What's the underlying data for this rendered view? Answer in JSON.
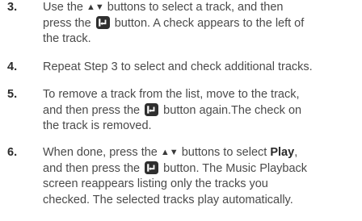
{
  "steps": [
    {
      "number": "3.",
      "lines": [
        [
          "Use the ",
          "▲▼",
          " buttons to select a track, and then"
        ],
        [
          "press the ",
          "[enter]",
          " button. A check appears to the left of"
        ],
        [
          "the track."
        ]
      ]
    },
    {
      "number": "4.",
      "lines": [
        [
          "Repeat Step 3 to select and check additional tracks."
        ]
      ]
    },
    {
      "number": "5.",
      "lines": [
        [
          "To remove a track from the list, move to the track,"
        ],
        [
          "and then press the ",
          "[enter]",
          " button again.The check on"
        ],
        [
          "the track is removed."
        ]
      ]
    },
    {
      "number": "6.",
      "lines": [
        [
          "When done, press the ",
          "▲▼",
          " buttons to select ",
          "Play",
          ","
        ],
        [
          "and then press the ",
          "[enter]",
          " button. The Music Playback"
        ],
        [
          "screen reappears listing only the tracks you"
        ],
        [
          "checked. The selected tracks play automatically."
        ]
      ]
    }
  ],
  "text": {
    "s3_l1_a": "Use the ",
    "s3_l1_arrows": "▲▼",
    "s3_l1_b": " buttons to select a track, and then",
    "s3_l2_a": "press the ",
    "s3_l2_b": " button. A check appears to the left of",
    "s3_l3": "the track.",
    "s4_l1": "Repeat Step 3 to select and check additional tracks.",
    "s5_l1": "To remove a track from the list, move to the track,",
    "s5_l2_a": "and then press the ",
    "s5_l2_b": " button again.The check on",
    "s5_l3": "the track is removed.",
    "s6_l1_a": "When done, press the ",
    "s6_l1_arrows": "▲▼",
    "s6_l1_b": " buttons to select ",
    "s6_l1_bold": "Play",
    "s6_l1_c": ",",
    "s6_l2_a": "and then press the ",
    "s6_l2_b": " button. The Music Playback",
    "s6_l3": "screen reappears listing only the tracks you",
    "s6_l4": "checked. The selected tracks play automatically."
  },
  "numbers": {
    "s3": "3.",
    "s4": "4.",
    "s5": "5.",
    "s6": "6."
  },
  "icons": {
    "enter_button": "enter-button-icon",
    "up_down_arrows": "up-down-arrows-icon"
  },
  "colors": {
    "body_text": "#4a4a4a",
    "number_text": "#2b2b2b",
    "icon_fill": "#2f2f2f"
  }
}
